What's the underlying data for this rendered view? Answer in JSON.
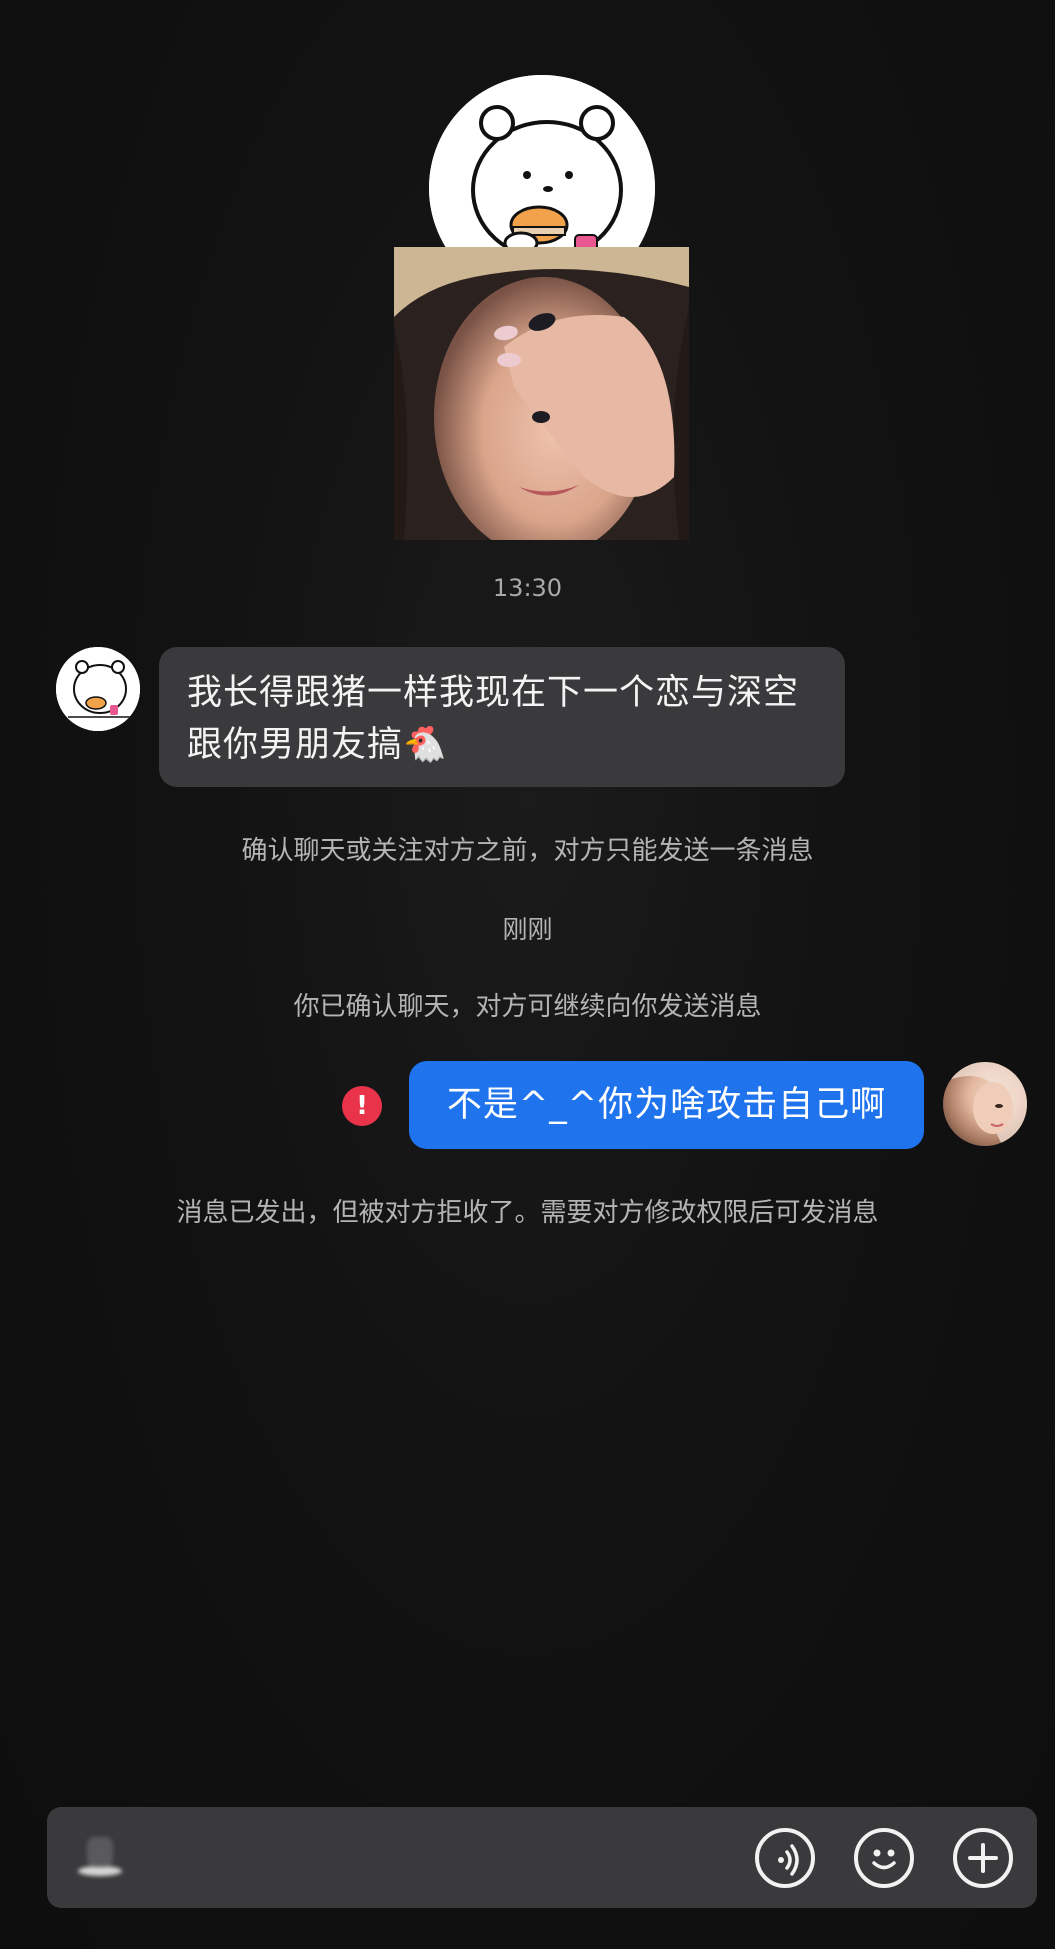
{
  "chat": {
    "time_header": "13:30",
    "incoming_message": {
      "text": "我长得跟猪一样我现在下一个恋与深空跟你男朋友搞",
      "emoji": "🐔"
    },
    "notice_limit": "确认聊天或关注对方之前，对方只能发送一条消息",
    "time_just_now": "刚刚",
    "notice_confirmed": "你已确认聊天，对方可继续向你发送消息",
    "outgoing_message": {
      "text": "不是^_^你为啥攻击自己啊",
      "status": "failed"
    },
    "notice_rejected": "消息已发出，但被对方拒收了。需要对方修改权限后可发消息"
  },
  "composer": {
    "placeholder": "",
    "buttons": {
      "voice_icon": "voice-wave-icon",
      "emoji_icon": "smiley-icon",
      "plus_icon": "plus-icon"
    }
  },
  "colors": {
    "background": "#111111",
    "incoming_bubble": "#3a3a3c",
    "outgoing_bubble": "#1f74ee",
    "error": "#e8334a",
    "system_text": "#b4b4b4"
  }
}
